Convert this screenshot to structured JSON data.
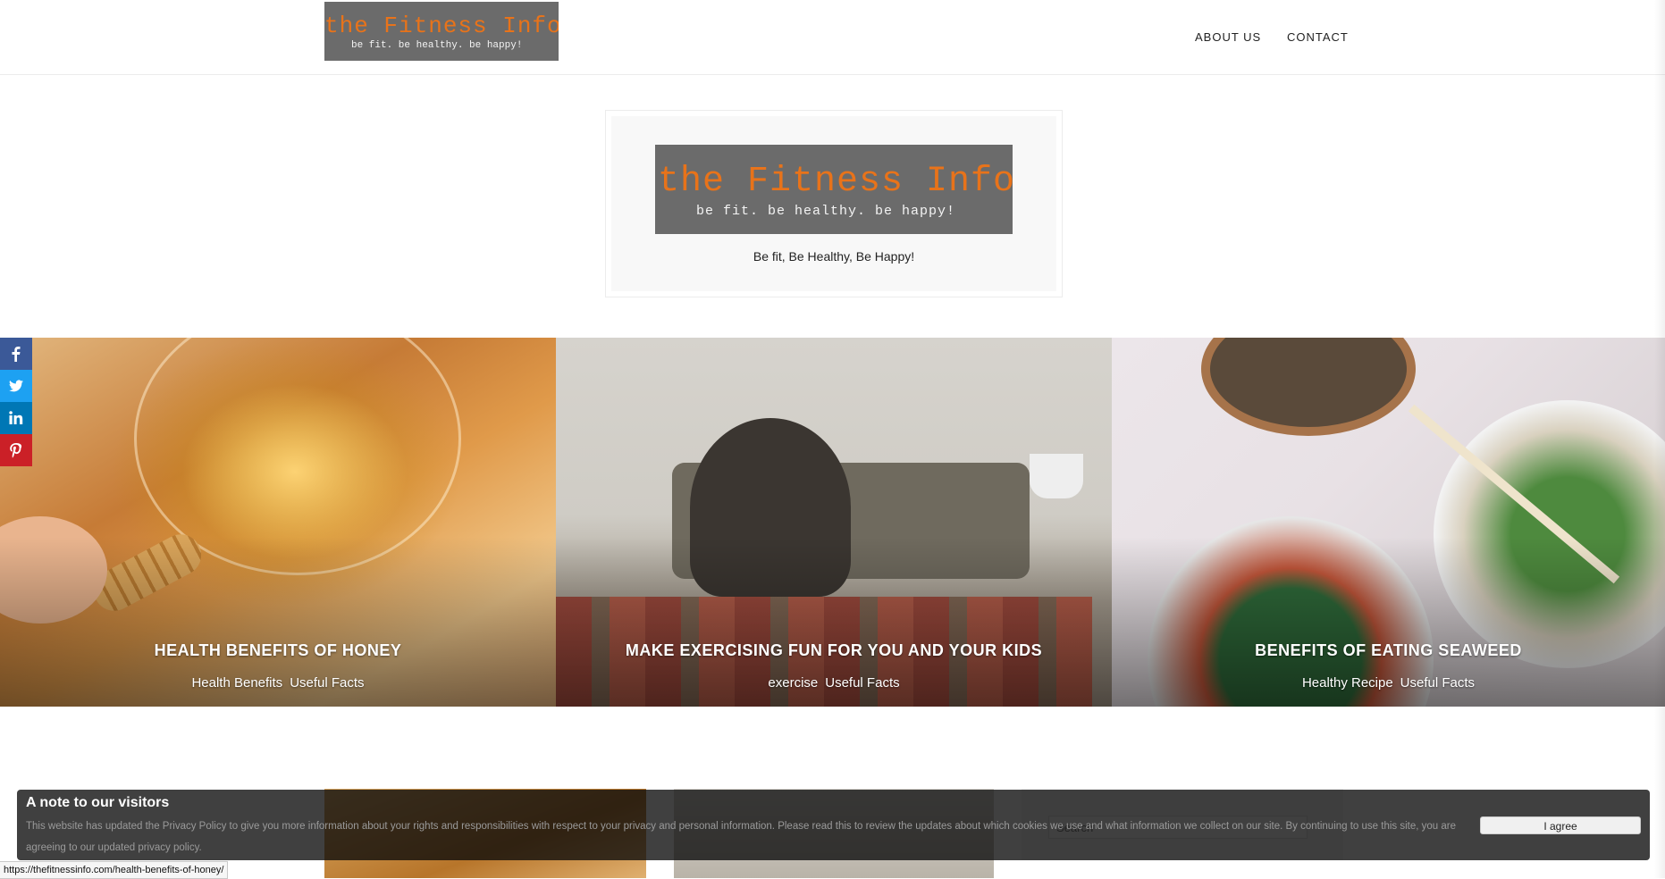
{
  "header": {
    "logo": {
      "line1": "the Fitness Info",
      "line2": "be fit. be healthy. be happy!"
    },
    "nav": [
      {
        "label": "ABOUT US"
      },
      {
        "label": "CONTACT"
      }
    ]
  },
  "brand_card": {
    "logo": {
      "line1": "the Fitness Info",
      "line2": "be fit. be healthy. be happy!"
    },
    "tagline": "Be fit, Be Healthy, Be Happy!"
  },
  "share": {
    "icons": [
      "facebook-icon",
      "twitter-icon",
      "linkedin-icon",
      "pinterest-icon"
    ],
    "colors": {
      "facebook": "#3b5998",
      "twitter": "#1da1f2",
      "linkedin": "#0077b5",
      "pinterest": "#cb2027"
    }
  },
  "featured": [
    {
      "title": "HEALTH BENEFITS OF HONEY",
      "categories": [
        "Health Benefits",
        "Useful Facts"
      ]
    },
    {
      "title": "MAKE EXERCISING FUN FOR YOU AND YOUR KIDS",
      "categories": [
        "exercise",
        "Useful Facts"
      ]
    },
    {
      "title": "BENEFITS OF EATING SEAWEED",
      "categories": [
        "Healthy Recipe",
        "Useful Facts"
      ]
    }
  ],
  "sidebar": {
    "search_placeholder": "Search"
  },
  "cookie_notice": {
    "title": "A note to our visitors",
    "text": "This website has updated the Privacy Policy to give you more information about your rights and responsibilities with respect to your privacy and personal information. Please read this to review the updates about which cookies we use and what information we collect on our site. By continuing to use this site, you are agreeing to our updated privacy policy.",
    "button": "I agree"
  },
  "status_bar": {
    "url": "https://thefitnessinfo.com/health-benefits-of-honey/"
  }
}
